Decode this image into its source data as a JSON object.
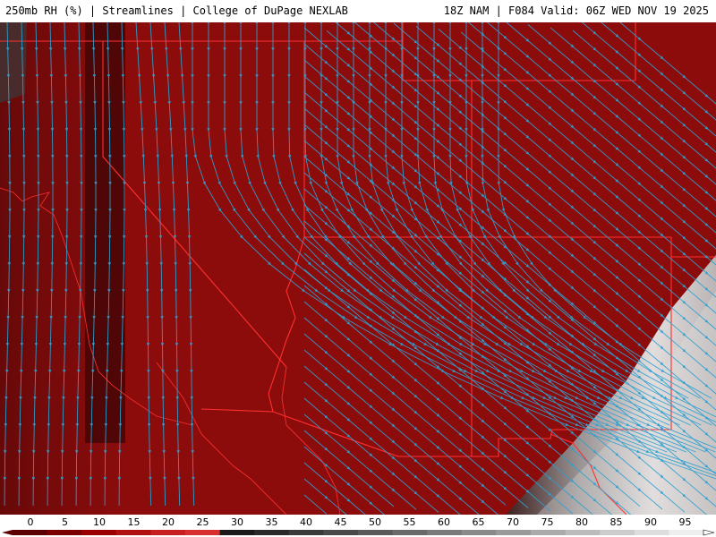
{
  "header": {
    "title": "250mb RH (%) | Streamlines | College of DuPage NEXLAB",
    "valid": "18Z NAM | F084 Valid: 06Z WED NOV 19 2025"
  },
  "map": {
    "field": "250mb relative humidity",
    "overlay": "streamlines",
    "colors": {
      "dry": "#8c0c0c",
      "dry_dark": "#5a0505",
      "moist": "#d8d8d8",
      "border": "#ff3030",
      "streamline": "#2fa0d0"
    }
  },
  "legend": {
    "ticks": [
      "0",
      "5",
      "10",
      "15",
      "20",
      "25",
      "30",
      "35",
      "40",
      "45",
      "50",
      "55",
      "60",
      "65",
      "70",
      "75",
      "80",
      "85",
      "90",
      "95"
    ],
    "colors": [
      "#5a0000",
      "#7a0000",
      "#9a0000",
      "#b01010",
      "#c82020",
      "#d83030",
      "#1a1a1a",
      "#2a2a2a",
      "#3a3a3a",
      "#4a4a4a",
      "#5a5a5a",
      "#6a6a6a",
      "#7a7a7a",
      "#8a8a8a",
      "#9a9a9a",
      "#aaaaaa",
      "#bbbbbb",
      "#cccccc",
      "#dddddd",
      "#eeeeee"
    ]
  }
}
